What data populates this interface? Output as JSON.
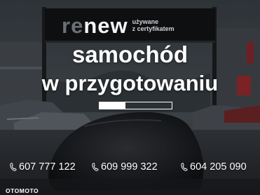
{
  "sign": {
    "logo_re": "re",
    "logo_new": "new",
    "tagline_line1": "używane",
    "tagline_line2": "z certyfikatem"
  },
  "headline": {
    "line1": "samochód",
    "line2": "w przygotowaniu"
  },
  "progress": {
    "fill_fraction": 0.36
  },
  "phones": [
    {
      "number": "607 777 122",
      "icon": "phone-icon"
    },
    {
      "number": "609 999 322",
      "icon": "phone-icon"
    },
    {
      "number": "604 205 090",
      "icon": "phone-icon"
    }
  ],
  "watermark": "OTOMOTO",
  "colors": {
    "text": "#ffffff",
    "logo_re": "#6a7075",
    "background": "#1b1e22"
  }
}
